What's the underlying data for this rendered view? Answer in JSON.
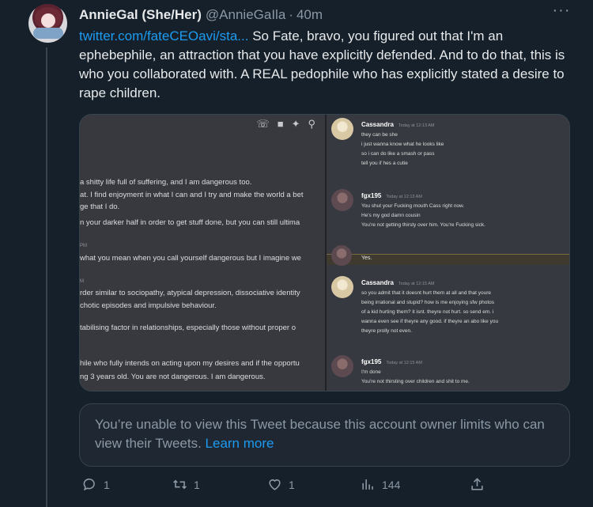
{
  "tweet": {
    "author_name": "AnnieGal (She/Her)",
    "author_handle": "@AnnieGaIla",
    "separator": "·",
    "time": "40m",
    "more": "···",
    "link_text": "twitter.com/fateCEOavi/sta...",
    "body": " So Fate, bravo, you figured out that I'm an ephebephile, an attraction that you have explicitly defended. And to do that, this is who you collaborated with. A REAL pedophile who has explicitly stated a desire to rape children."
  },
  "media": {
    "left_lines": [
      "a shitty life full of suffering, and I am dangerous too.",
      "at. I find enjoyment in what I can and I try and make the world a bet",
      "ge that I do.",
      "n your darker half in order to get stuff done, but you can still ultima",
      "PM",
      "what you mean when you call yourself dangerous but I imagine we",
      "M",
      "rder similar to sociopathy, atypical depression, dissociative identity",
      "chotic episodes and impulsive behaviour.",
      "tabilising factor in relationships, especially those without proper o",
      "hile who fully intends on acting upon my desires and if the opportu",
      "ng 3 years old. You are not dangerous. I am dangerous."
    ],
    "right_messages": [
      {
        "author": "Cassandra",
        "time": "Today at 12:13 AM",
        "lines": [
          "they can be she",
          "i just wanna know what he looks like",
          "so i can do like a smash or pass",
          "tell you if hes a cutie"
        ]
      },
      {
        "author": "fgx195",
        "time": "Today at 12:13 AM",
        "lines": [
          "You shut your Fucking mouth Cass right now.",
          "He's my god damn cousin",
          "You're not getting thirsty over him. You're Fucking sick."
        ]
      },
      {
        "author": "",
        "time": "",
        "lines": [
          "Yes."
        ]
      },
      {
        "author": "Cassandra",
        "time": "Today at 12:15 AM",
        "lines": [
          "so you admit that it doesnt hurt them at all and that youre",
          "being irrational and stupid? how is me enjoying sfw photos",
          "of a kid hurting them? it isnt. theyre not hurt. so send em. i",
          "wanna even see if theyre any good. if theyre an abo like you",
          "theyre prolly not even."
        ]
      },
      {
        "author": "fgx195",
        "time": "Today at 12:15 AM",
        "lines": [
          "I'm done",
          "You're not thirsting over children and shit to me."
        ]
      }
    ]
  },
  "notice": {
    "text": "You’re unable to view this Tweet because this account owner limits who can view their Tweets. ",
    "learn_more": "Learn more"
  },
  "actions": {
    "reply_count": "1",
    "retweet_count": "1",
    "like_count": "1",
    "views_count": "144"
  }
}
